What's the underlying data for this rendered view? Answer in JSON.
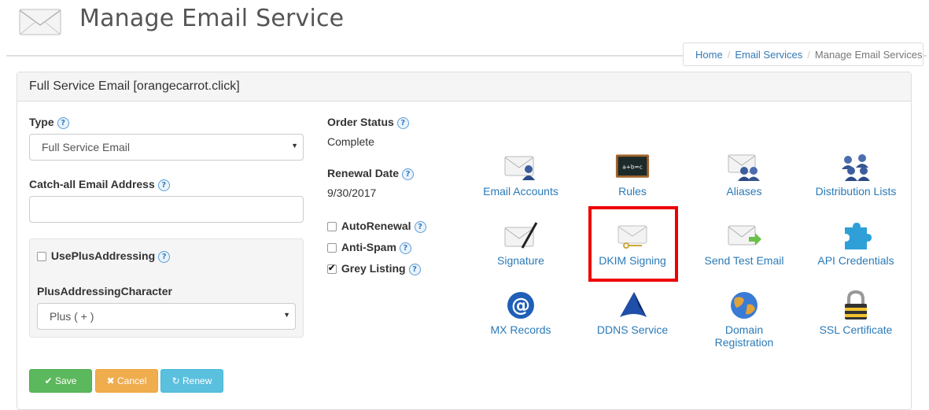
{
  "header": {
    "title": "Manage Email Service"
  },
  "breadcrumb": {
    "home": "Home",
    "email_services": "Email Services",
    "current": "Manage Email Services"
  },
  "panel": {
    "title": "Full Service Email [orangecarrot.click]"
  },
  "form": {
    "type_label": "Type",
    "type_value": "Full Service Email",
    "catchall_label": "Catch-all Email Address",
    "catchall_value": "",
    "useplus_label": "UsePlusAddressing",
    "useplus_checked": false,
    "pluschar_label": "PlusAddressingCharacter",
    "pluschar_value": "Plus ( + )"
  },
  "status": {
    "order_label": "Order Status",
    "order_value": "Complete",
    "renewal_label": "Renewal Date",
    "renewal_value": "9/30/2017",
    "autorenewal_label": "AutoRenewal",
    "autorenewal_checked": false,
    "antispam_label": "Anti-Spam",
    "antispam_checked": false,
    "grey_label": "Grey Listing",
    "grey_checked": true
  },
  "buttons": {
    "save": "Save",
    "cancel": "Cancel",
    "renew": "Renew"
  },
  "tools": [
    {
      "label": "Email Accounts",
      "icon": "email-accounts-icon"
    },
    {
      "label": "Rules",
      "icon": "chalkboard-icon"
    },
    {
      "label": "Aliases",
      "icon": "aliases-icon"
    },
    {
      "label": "Distribution Lists",
      "icon": "group-icon"
    },
    {
      "label": "Signature",
      "icon": "signature-pen-icon"
    },
    {
      "label": "DKIM Signing",
      "icon": "envelope-key-icon"
    },
    {
      "label": "Send Test Email",
      "icon": "envelope-arrow-icon"
    },
    {
      "label": "API Credentials",
      "icon": "puzzle-icon"
    },
    {
      "label": "MX Records",
      "icon": "at-sign-icon"
    },
    {
      "label": "DDNS Service",
      "icon": "ddns-logo-icon"
    },
    {
      "label": "Domain Registration",
      "icon": "globe-icon"
    },
    {
      "label": "SSL Certificate",
      "icon": "padlock-icon"
    }
  ],
  "colors": {
    "link": "#2a7ab8",
    "save": "#5cb85c",
    "cancel": "#f0ad4e",
    "renew": "#5bc0de",
    "highlight": "#ee0000"
  }
}
